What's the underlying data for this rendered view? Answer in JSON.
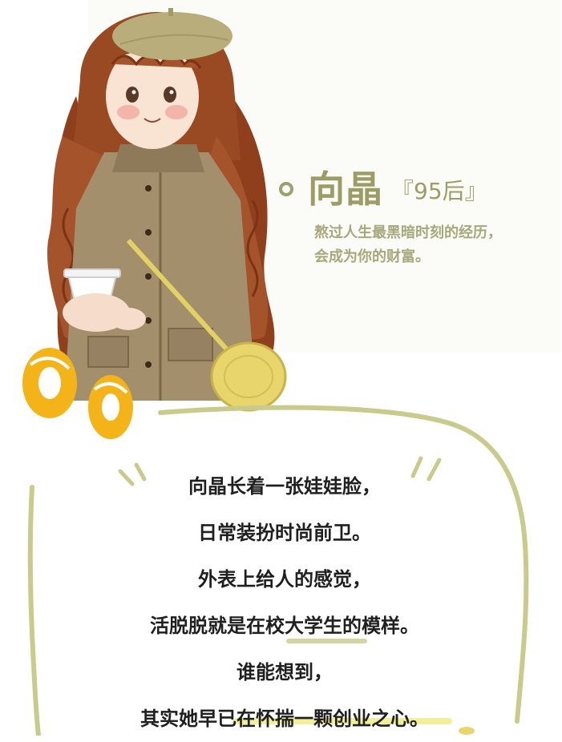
{
  "profile": {
    "name": "向晶",
    "tag": "『95后』",
    "subtitle_lines": [
      "熬过人生最黑暗时刻的经历，",
      "会成为你的财富。"
    ]
  },
  "story": {
    "lines": [
      "向晶长着一张娃娃脸，",
      "日常装扮时尚前卫。",
      "外表上给人的感觉，",
      "活脱脱就是在校大学生的模样。",
      "谁能想到，",
      "其实她早已在怀揣一颗创业之心。"
    ]
  },
  "colors": {
    "accent_olive": "#9b9d64",
    "frame_olive": "#c9cb8d",
    "hair": "#9a4a22",
    "coat": "#a18f6d",
    "beret": "#b8ad7a",
    "bag": "#e6d36a",
    "donut": "#f1b21b"
  }
}
